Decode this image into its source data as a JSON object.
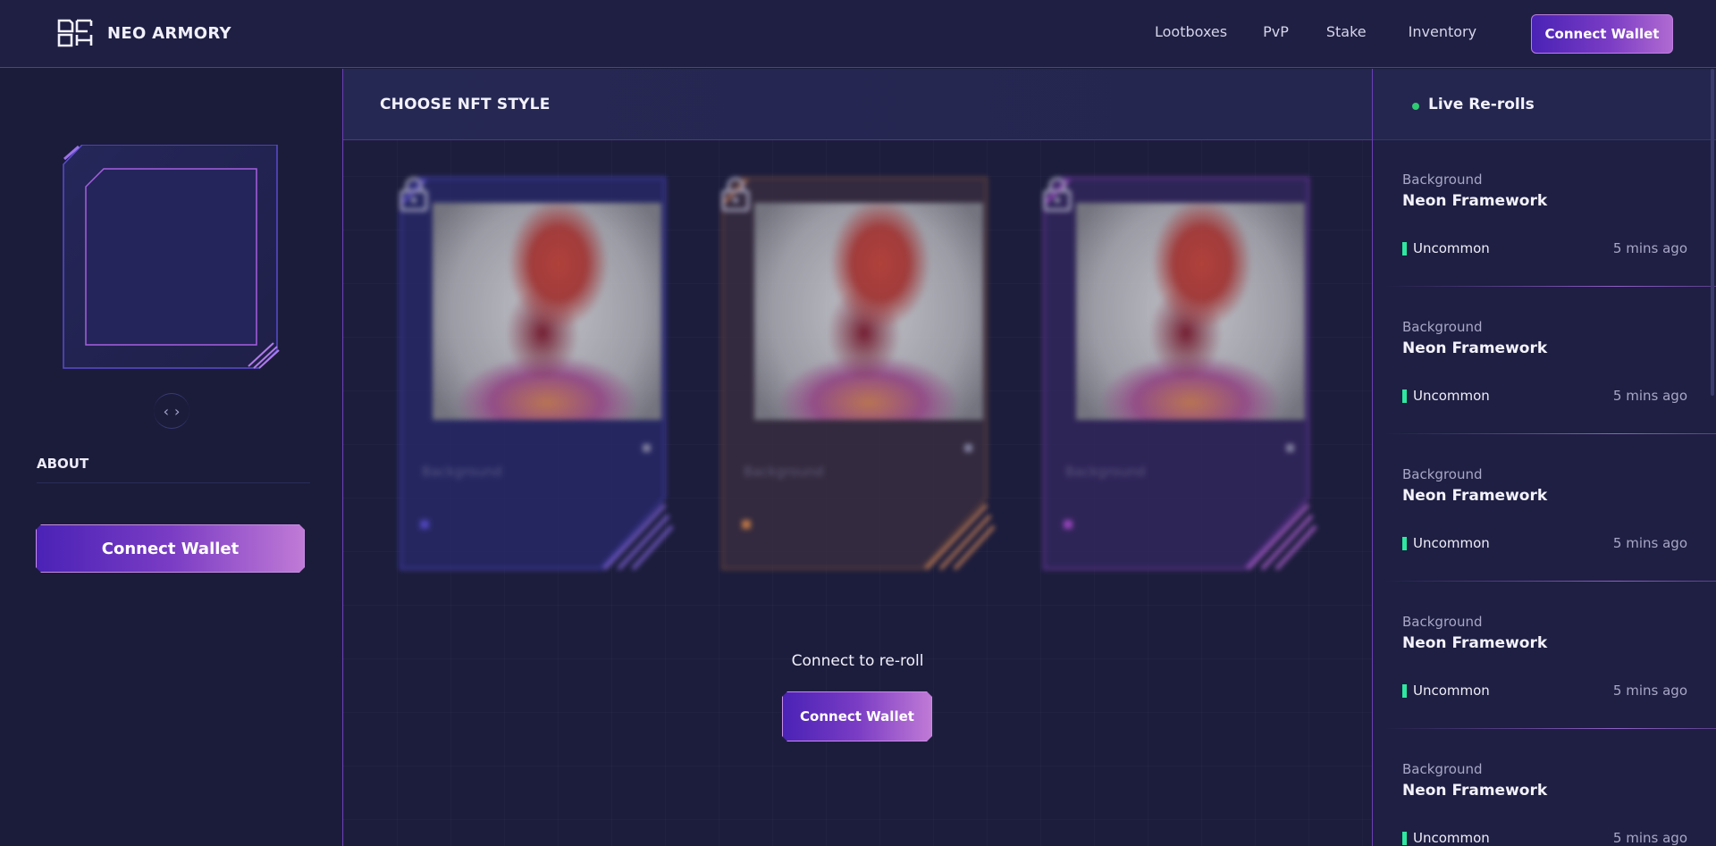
{
  "header": {
    "logo_text": "NEO ARMORY",
    "nav": [
      "Lootboxes",
      "PvP",
      "Stake",
      "Inventory"
    ],
    "connect_label": "Connect Wallet"
  },
  "left": {
    "pager_prev": "‹",
    "pager_next": "›",
    "about_label": "ABOUT",
    "connect_label": "Connect Wallet"
  },
  "center": {
    "title": "CHOOSE NFT STYLE",
    "cards": [
      {
        "label": "Background",
        "accent": "#5b4fd8"
      },
      {
        "label": "Background",
        "accent": "#e08a4a"
      },
      {
        "label": "Background",
        "accent": "#b04ed6"
      }
    ],
    "connect_text": "Connect to re-roll",
    "connect_label": "Connect Wallet"
  },
  "right": {
    "title": "Live Re-rolls",
    "feed": [
      {
        "category": "Background",
        "name": "Neon Framework",
        "rarity": "Uncommon",
        "time": "5 mins ago"
      },
      {
        "category": "Background",
        "name": "Neon Framework",
        "rarity": "Uncommon",
        "time": "5 mins ago"
      },
      {
        "category": "Background",
        "name": "Neon Framework",
        "rarity": "Uncommon",
        "time": "5 mins ago"
      },
      {
        "category": "Background",
        "name": "Neon Framework",
        "rarity": "Uncommon",
        "time": "5 mins ago"
      },
      {
        "category": "Background",
        "name": "Neon Framework",
        "rarity": "Uncommon",
        "time": "5 mins ago"
      }
    ]
  },
  "colors": {
    "accent_purple": "#7a3cc4",
    "live_green": "#2ecc71",
    "uncommon": "#2ee8a0"
  }
}
